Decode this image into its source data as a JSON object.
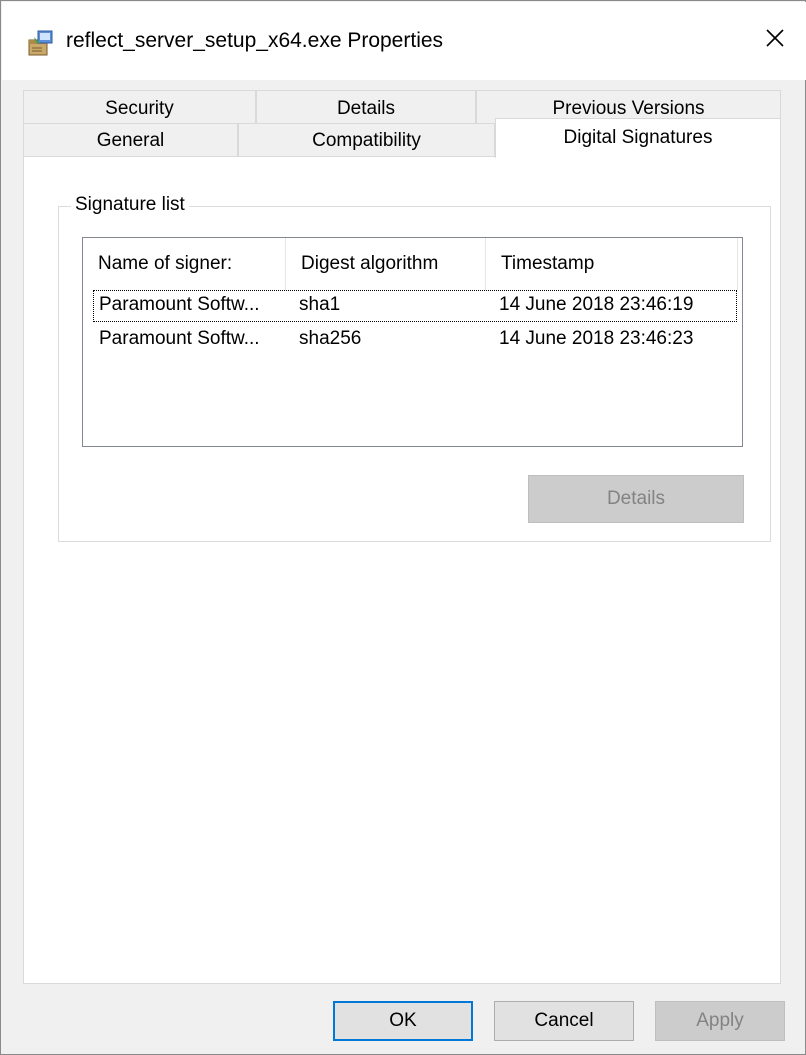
{
  "window": {
    "title": "reflect_server_setup_x64.exe Properties",
    "close_symbol": "✕",
    "icon": "installer-package-icon"
  },
  "tabs": {
    "row_back": [
      {
        "label": "Security"
      },
      {
        "label": "Details"
      },
      {
        "label": "Previous Versions"
      }
    ],
    "row_front": [
      {
        "label": "General"
      },
      {
        "label": "Compatibility"
      },
      {
        "label": "Digital Signatures"
      }
    ],
    "active": "Digital Signatures"
  },
  "signature_list": {
    "group_label": "Signature list",
    "columns": [
      "Name of signer:",
      "Digest algorithm",
      "Timestamp"
    ],
    "rows": [
      {
        "signer": "Paramount Softw...",
        "digest": "sha1",
        "timestamp": "14 June 2018 23:46:19"
      },
      {
        "signer": "Paramount Softw...",
        "digest": "sha256",
        "timestamp": "14 June 2018 23:46:23"
      }
    ],
    "details_button": "Details"
  },
  "footer": {
    "ok": "OK",
    "cancel": "Cancel",
    "apply": "Apply"
  },
  "colors": {
    "accent": "#0078d7",
    "dialog_bg": "#f0f0f0",
    "panel_bg": "#ffffff",
    "disabled_text": "#838383"
  }
}
